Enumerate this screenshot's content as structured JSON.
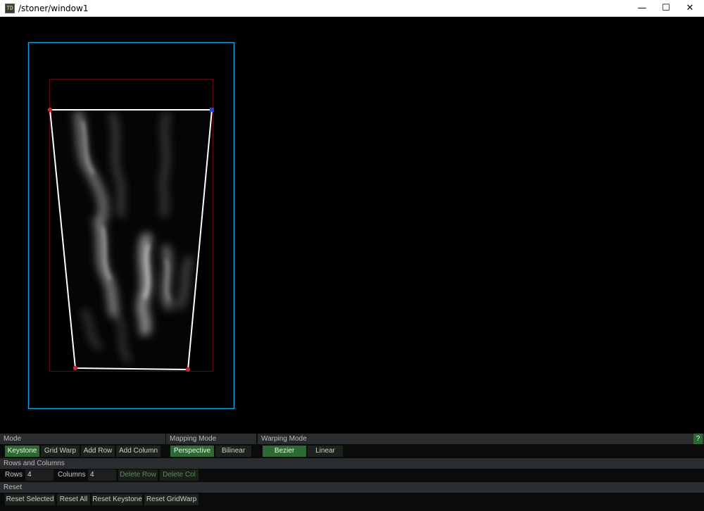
{
  "window": {
    "title": "/stoner/window1",
    "app_icon_label": "TD",
    "controls": {
      "minimize": "—",
      "maximize": "☐",
      "close": "✕"
    }
  },
  "colors": {
    "canvas_border": "#1e9fe0",
    "bounds_border": "#5a0a14",
    "quad_line": "#ffffff",
    "handle_red": "#c62a2a",
    "handle_blue": "#2a3fd0",
    "active_button": "#2d6a33",
    "section_header": "#2a2d2f"
  },
  "panel": {
    "mode": {
      "header": "Mode",
      "buttons": [
        {
          "label": "Keystone",
          "active": true
        },
        {
          "label": "Grid Warp",
          "active": false
        },
        {
          "label": "Add Row",
          "active": false
        },
        {
          "label": "Add Column",
          "active": false
        }
      ]
    },
    "mapping_mode": {
      "header": "Mapping Mode",
      "buttons": [
        {
          "label": "Perspective",
          "active": true
        },
        {
          "label": "Bilinear",
          "active": false
        }
      ]
    },
    "warping_mode": {
      "header": "Warping Mode",
      "buttons": [
        {
          "label": "Bezier",
          "active": true
        },
        {
          "label": "Linear",
          "active": false
        }
      ]
    },
    "help_label": "?",
    "rows_columns": {
      "header": "Rows and Columns",
      "rows_label": "Rows",
      "rows_value": "4",
      "columns_label": "Columns",
      "columns_value": "4",
      "delete_row": "Delete Row",
      "delete_col": "Delete Col"
    },
    "reset": {
      "header": "Reset",
      "buttons": [
        "Reset Selected",
        "Reset All",
        "Reset Keystone",
        "Reset GridWarp"
      ]
    }
  }
}
